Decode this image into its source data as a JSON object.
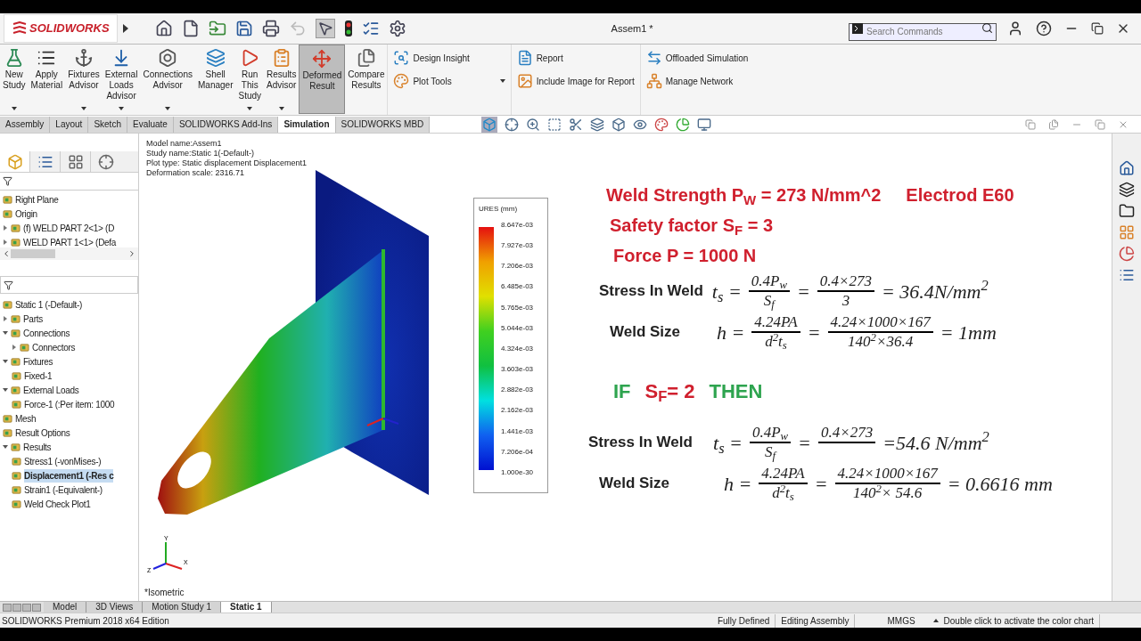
{
  "title_bar": {
    "logo": "SOLIDWORKS",
    "document_title": "Assem1 *",
    "search": {
      "placeholder": "Search Commands"
    }
  },
  "ribbon": {
    "large_buttons": [
      {
        "lines": [
          "New",
          "Study"
        ],
        "dropdown": true,
        "selected": false
      },
      {
        "lines": [
          "Apply",
          "Material"
        ],
        "dropdown": false,
        "selected": false
      },
      {
        "lines": [
          "Fixtures",
          "Advisor"
        ],
        "dropdown": true,
        "selected": false
      },
      {
        "lines": [
          "External",
          "Loads",
          "Advisor"
        ],
        "dropdown": true,
        "selected": false
      },
      {
        "lines": [
          "Connections",
          "Advisor"
        ],
        "dropdown": true,
        "selected": false
      },
      {
        "lines": [
          "Shell",
          "Manager"
        ],
        "dropdown": false,
        "selected": false
      },
      {
        "lines": [
          "Run",
          "This",
          "Study"
        ],
        "dropdown": true,
        "selected": false
      },
      {
        "lines": [
          "Results",
          "Advisor"
        ],
        "dropdown": true,
        "selected": false
      },
      {
        "lines": [
          "Deformed",
          "Result"
        ],
        "dropdown": false,
        "selected": true
      },
      {
        "lines": [
          "Compare",
          "Results"
        ],
        "dropdown": false,
        "selected": false
      }
    ],
    "small_groups": [
      [
        {
          "label": "Design Insight",
          "dropdown": false
        },
        {
          "label": "Plot Tools",
          "dropdown": true
        }
      ],
      [
        {
          "label": "Report",
          "dropdown": false
        },
        {
          "label": "Include Image for Report",
          "dropdown": false
        }
      ],
      [
        {
          "label": "Offloaded Simulation",
          "dropdown": false
        },
        {
          "label": "Manage Network",
          "dropdown": false
        }
      ]
    ]
  },
  "command_tabs": [
    {
      "label": "Assembly",
      "selected": false
    },
    {
      "label": "Layout",
      "selected": false
    },
    {
      "label": "Sketch",
      "selected": false
    },
    {
      "label": "Evaluate",
      "selected": false
    },
    {
      "label": "SOLIDWORKS Add-Ins",
      "selected": false
    },
    {
      "label": "Simulation",
      "selected": true
    },
    {
      "label": "SOLIDWORKS MBD",
      "selected": false
    }
  ],
  "feature_tree": [
    {
      "label": "Right Plane",
      "selected": false
    },
    {
      "label": "Origin",
      "selected": false
    },
    {
      "label": "(f) WELD PART 2<1> (D",
      "expanded": false,
      "selected": false
    },
    {
      "label": "WELD PART 1<1> (Defa",
      "expanded": false,
      "selected": false
    }
  ],
  "study_tree": [
    {
      "label": "Static 1 (-Default-)",
      "selected": false
    },
    {
      "label": "Parts",
      "expanded": false,
      "selected": false
    },
    {
      "label": "Connections",
      "expanded": true,
      "selected": false,
      "children": [
        {
          "label": "Connectors",
          "expanded": false,
          "selected": false
        }
      ]
    },
    {
      "label": "Fixtures",
      "expanded": true,
      "selected": false,
      "children": [
        {
          "label": "Fixed-1",
          "selected": false
        }
      ]
    },
    {
      "label": "External Loads",
      "expanded": true,
      "selected": false,
      "children": [
        {
          "label": "Force-1 (:Per item: 1000",
          "selected": false
        }
      ]
    },
    {
      "label": "Mesh",
      "selected": false
    },
    {
      "label": "Result Options",
      "selected": false
    },
    {
      "label": "Results",
      "expanded": true,
      "selected": false,
      "children": [
        {
          "label": "Stress1 (-vonMises-)",
          "selected": false
        },
        {
          "label": "Displacement1 (-Res c",
          "selected": true
        },
        {
          "label": "Strain1 (-Equivalent-)",
          "selected": false
        },
        {
          "label": "Weld Check Plot1",
          "selected": false
        }
      ]
    }
  ],
  "viewport": {
    "info": [
      "Model name:Assem1",
      "Study name:Static 1(-Default-)",
      "Plot type: Static displacement Displacement1",
      "Deformation scale: 2316.71"
    ],
    "legend": {
      "title": "URES (mm)",
      "ticks": [
        "8.647e-03",
        "7.927e-03",
        "7.206e-03",
        "6.485e-03",
        "5.765e-03",
        "5.044e-03",
        "4.324e-03",
        "3.603e-03",
        "2.882e-03",
        "2.162e-03",
        "1.441e-03",
        "7.206e-04",
        "1.000e-30"
      ]
    },
    "triad": [
      "Y",
      "X",
      "Z"
    ],
    "view_name": "*Isometric"
  },
  "notes": {
    "header": [
      [
        {
          "text": "Weld Strength  P$_{W}$ = 273 N/mm^2",
          "color": "#d0202e"
        },
        {
          "text": "Electrod  E60",
          "color": "#d0202e"
        }
      ],
      [
        {
          "text": "Safety factor  S$_{F}$ = 3",
          "color": "#d0202e"
        }
      ],
      [
        {
          "text": "Force P = 1000 N",
          "color": "#d0202e"
        }
      ]
    ],
    "formulas_1": [
      {
        "label": "Stress In Weld",
        "parts": [
          {
            "kind": "text",
            "text": "t$_{s}$ ="
          },
          {
            "kind": "frac",
            "num": "0.4P$_{w}$",
            "den": "S$_{f}$"
          },
          {
            "kind": "text",
            "text": "="
          },
          {
            "kind": "frac",
            "num": "0.4×273",
            "den": "3"
          },
          {
            "kind": "text",
            "text": "= 36.4N/mm$^{2}$"
          }
        ]
      },
      {
        "label": "Weld Size",
        "parts": [
          {
            "kind": "text",
            "text": "h ="
          },
          {
            "kind": "frac",
            "num": "4.24PA",
            "den": "d$^{2}$t$_{s}$"
          },
          {
            "kind": "text",
            "text": "="
          },
          {
            "kind": "frac",
            "num": "4.24×1000×167",
            "den": "140$^{2}$×36.4"
          },
          {
            "kind": "text",
            "text": "= 1mm"
          }
        ]
      }
    ],
    "condition": [
      {
        "text": "IF",
        "color": "#2ea44f"
      },
      {
        "text": "S$_{F}$= 2",
        "color": "#d0202e"
      },
      {
        "text": "THEN",
        "color": "#2ea44f"
      }
    ],
    "formulas_2": [
      {
        "label": "Stress In Weld",
        "parts": [
          {
            "kind": "text",
            "text": "t$_{s}$ ="
          },
          {
            "kind": "frac",
            "num": "0.4P$_{w}$",
            "den": "S$_{f}$"
          },
          {
            "kind": "text",
            "text": "="
          },
          {
            "kind": "frac",
            "num": "0.4×273"
          },
          {
            "kind": "text",
            "text": "=54.6 N/mm$^{2}$"
          }
        ]
      },
      {
        "label": "Weld Size",
        "parts": [
          {
            "kind": "text",
            "text": "h ="
          },
          {
            "kind": "frac",
            "num": "4.24PA",
            "den": "d$^{2}$t$_{s}$"
          },
          {
            "kind": "text",
            "text": "="
          },
          {
            "kind": "frac",
            "num": "4.24×1000×167",
            "den": "140$^{2}$× 54.6"
          },
          {
            "kind": "text",
            "text": "= 0.6616 mm"
          }
        ]
      }
    ]
  },
  "bottom_tabs": [
    {
      "label": "Model",
      "selected": false
    },
    {
      "label": "3D Views",
      "selected": false
    },
    {
      "label": "Motion Study 1",
      "selected": false
    },
    {
      "label": "Static 1",
      "selected": true
    }
  ],
  "status_bar": {
    "edition": "SOLIDWORKS Premium 2018 x64 Edition",
    "state": "Fully Defined",
    "mode": "Editing Assembly",
    "units": "MMGS",
    "hint": "Double click to activate the color chart"
  }
}
